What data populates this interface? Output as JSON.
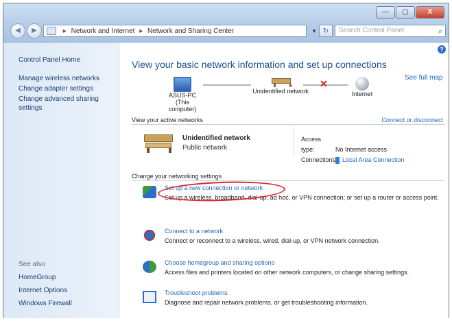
{
  "window": {
    "buttons": {
      "minimize": "—",
      "maximize": "▢",
      "close": "X"
    }
  },
  "nav": {
    "back": "◀",
    "forward": "▶",
    "address_segments": [
      "Network and Internet",
      "Network and Sharing Center"
    ],
    "address_separator": "▸",
    "dropdown": "▾",
    "refresh": "↻",
    "search_placeholder": "Search Control Panel",
    "search_icon": "⌕"
  },
  "sidebar": {
    "home": "Control Panel Home",
    "links": [
      "Manage wireless networks",
      "Change adapter settings",
      "Change advanced sharing settings"
    ],
    "see_also_label": "See also",
    "see_also": [
      "HomeGroup",
      "Internet Options",
      "Windows Firewall"
    ]
  },
  "main": {
    "help": "?",
    "title": "View your basic network information and set up connections",
    "see_full_map": "See full map",
    "map": {
      "computer": {
        "name": "ASUS-PC",
        "sub": "(This computer)"
      },
      "network": "Unidentified network",
      "internet": "Internet",
      "error_mark": "✕"
    },
    "active_header": "View your active networks",
    "connect_disconnect": "Connect or disconnect",
    "active_network": {
      "name": "Unidentified network",
      "type": "Public network",
      "access_type_label": "Access type:",
      "access_type_value": "No Internet access",
      "connections_label": "Connections:",
      "connections_value": "Local Area Connection"
    },
    "change_header": "Change your networking settings",
    "tasks": [
      {
        "icon": "setup-connection-icon",
        "link": "Set up a new connection or network",
        "desc": "Set up a wireless, broadband, dial-up, ad hoc, or VPN connection; or set up a router or access point."
      },
      {
        "icon": "connect-network-icon",
        "link": "Connect to a network",
        "desc": "Connect or reconnect to a wireless, wired, dial-up, or VPN network connection."
      },
      {
        "icon": "homegroup-icon",
        "link": "Choose homegroup and sharing options",
        "desc": "Access files and printers located on other network computers, or change sharing settings."
      },
      {
        "icon": "troubleshoot-icon",
        "link": "Troubleshoot problems",
        "desc": "Diagnose and repair network problems, or get troubleshooting information."
      }
    ],
    "annotation_color": "#d8262c"
  }
}
